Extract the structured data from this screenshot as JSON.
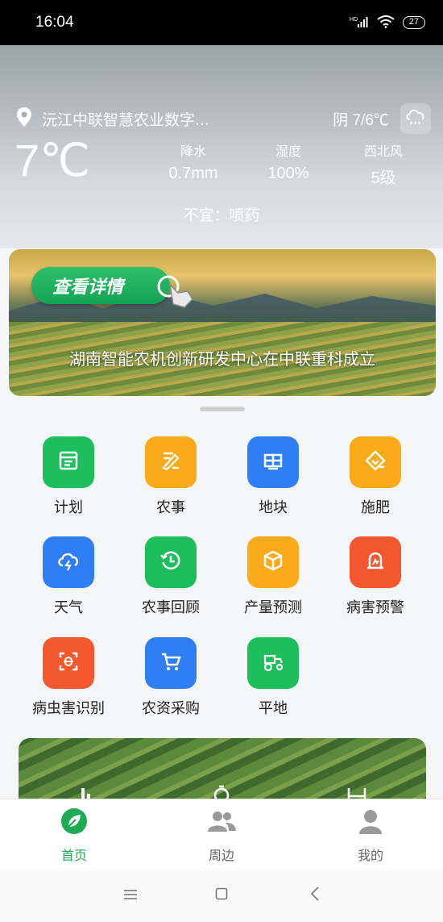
{
  "status_bar": {
    "time": "16:04",
    "network": "HD",
    "battery": "27"
  },
  "weather": {
    "location": "沅江中联智慧农业数字...",
    "condition": "阴 7/6℃",
    "temperature": "7℃",
    "stats": [
      {
        "label": "降水",
        "value": "0.7mm"
      },
      {
        "label": "湿度",
        "value": "100%"
      },
      {
        "label": "西北风",
        "value": "5级"
      }
    ],
    "advice": "不宜：喷药"
  },
  "banner": {
    "button_label": "查看详情",
    "caption": "湖南智能农机创新研发中心在中联重科成立"
  },
  "features": [
    {
      "label": "计划",
      "color": "#1dbf5c",
      "icon": "plan-icon"
    },
    {
      "label": "农事",
      "color": "#fbab19",
      "icon": "farm-work-icon"
    },
    {
      "label": "地块",
      "color": "#2f7ef5",
      "icon": "plot-icon"
    },
    {
      "label": "施肥",
      "color": "#fbab19",
      "icon": "fertilize-icon"
    },
    {
      "label": "天气",
      "color": "#2f7ef5",
      "icon": "weather-icon"
    },
    {
      "label": "农事回顾",
      "color": "#1dbf5c",
      "icon": "history-icon"
    },
    {
      "label": "产量预测",
      "color": "#fbab19",
      "icon": "yield-icon"
    },
    {
      "label": "病害预警",
      "color": "#f5582e",
      "icon": "alarm-icon"
    },
    {
      "label": "病虫害识别",
      "color": "#f5582e",
      "icon": "scan-icon"
    },
    {
      "label": "农资采购",
      "color": "#2f7ef5",
      "icon": "cart-icon"
    },
    {
      "label": "平地",
      "color": "#1dbf5c",
      "icon": "tractor-icon"
    }
  ],
  "tabs": [
    {
      "label": "首页",
      "active": true
    },
    {
      "label": "周边",
      "active": false
    },
    {
      "label": "我的",
      "active": false
    }
  ]
}
